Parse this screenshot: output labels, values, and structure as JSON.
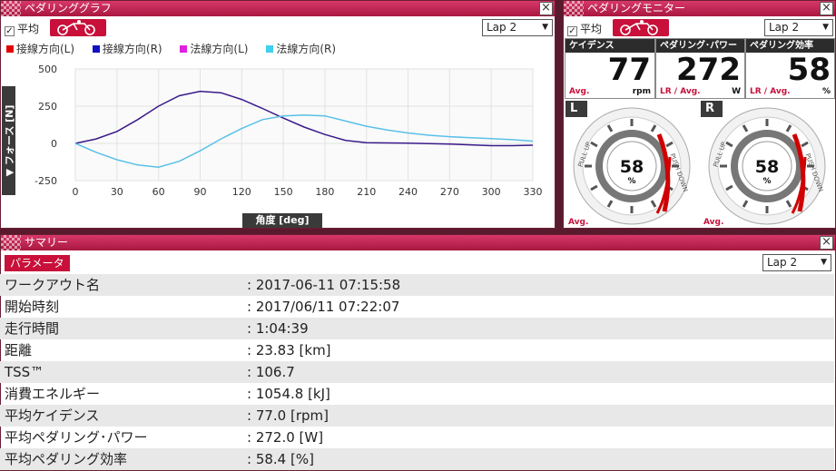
{
  "graph_panel": {
    "title": "ペダリンググラフ",
    "avg_label": "平均",
    "lap_select": "Lap 2",
    "legend": [
      {
        "label": "接線方向(L)",
        "color": "#e00000"
      },
      {
        "label": "接線方向(R)",
        "color": "#1010c0"
      },
      {
        "label": "法線方向(L)",
        "color": "#e020e0"
      },
      {
        "label": "法線方向(R)",
        "color": "#40d0f0"
      }
    ],
    "ylabel": "▼ フォース [N]",
    "xlabel": "角度 [deg]"
  },
  "chart_data": {
    "type": "line",
    "xlabel": "角度 [deg]",
    "ylabel": "▼ フォース [N]",
    "xlim": [
      0,
      330
    ],
    "ylim": [
      -250,
      500
    ],
    "xticks": [
      0,
      30,
      60,
      90,
      120,
      150,
      180,
      210,
      240,
      270,
      300,
      330
    ],
    "yticks": [
      500,
      250,
      0,
      -250
    ],
    "grid": true,
    "series": [
      {
        "name": "接線方向(R)",
        "color": "#3a1a8a",
        "x": [
          0,
          15,
          30,
          45,
          60,
          75,
          90,
          105,
          120,
          135,
          150,
          165,
          180,
          195,
          210,
          225,
          240,
          255,
          270,
          285,
          300,
          315,
          330
        ],
        "y": [
          0,
          30,
          80,
          160,
          250,
          320,
          350,
          340,
          295,
          235,
          170,
          110,
          60,
          20,
          5,
          3,
          2,
          -2,
          -5,
          -10,
          -15,
          -15,
          -12
        ]
      },
      {
        "name": "法線方向(R)",
        "color": "#5ac0e8",
        "x": [
          0,
          15,
          30,
          45,
          60,
          75,
          90,
          105,
          120,
          135,
          150,
          165,
          180,
          195,
          210,
          225,
          240,
          255,
          270,
          285,
          300,
          315,
          330
        ],
        "y": [
          0,
          -60,
          -110,
          -145,
          -160,
          -120,
          -50,
          30,
          100,
          160,
          185,
          190,
          185,
          150,
          115,
          90,
          70,
          55,
          45,
          38,
          32,
          25,
          15
        ]
      }
    ]
  },
  "monitor_panel": {
    "title": "ペダリングモニター",
    "avg_label": "平均",
    "lap_select": "Lap 2",
    "metrics": [
      {
        "header": "ケイデンス",
        "value": "77",
        "sub": "Avg.",
        "unit": "rpm"
      },
      {
        "header": "ペダリング･パワー",
        "value": "272",
        "sub": "LR / Avg.",
        "unit": "W"
      },
      {
        "header": "ペダリング効率",
        "value": "58",
        "sub": "LR / Avg.",
        "unit": "%"
      }
    ],
    "gauges": [
      {
        "side": "L",
        "value": "58",
        "unit": "%",
        "avg": "Avg.",
        "pull": "PULL UP",
        "push": "PUSH DOWN"
      },
      {
        "side": "R",
        "value": "58",
        "unit": "%",
        "avg": "Avg.",
        "pull": "PULL UP",
        "push": "PUSH DOWN"
      }
    ]
  },
  "summary_panel": {
    "title": "サマリー",
    "tab": "パラメータ",
    "lap_select": "Lap 2",
    "rows": [
      {
        "key": "ワークアウト名",
        "value": ": 2017-06-11 07:15:58"
      },
      {
        "key": "開始時刻",
        "value": ": 2017/06/11 07:22:07"
      },
      {
        "key": "走行時間",
        "value": ": 1:04:39"
      },
      {
        "key": "距離",
        "value": ": 23.83 [km]"
      },
      {
        "key": "TSS™",
        "value": ": 106.7"
      },
      {
        "key": "消費エネルギー",
        "value": ": 1054.8 [kJ]"
      },
      {
        "key": "平均ケイデンス",
        "value": ": 77.0 [rpm]"
      },
      {
        "key": "平均ペダリング･パワー",
        "value": ": 272.0 [W]"
      },
      {
        "key": "平均ペダリング効率",
        "value": ": 58.4 [%]"
      }
    ]
  }
}
